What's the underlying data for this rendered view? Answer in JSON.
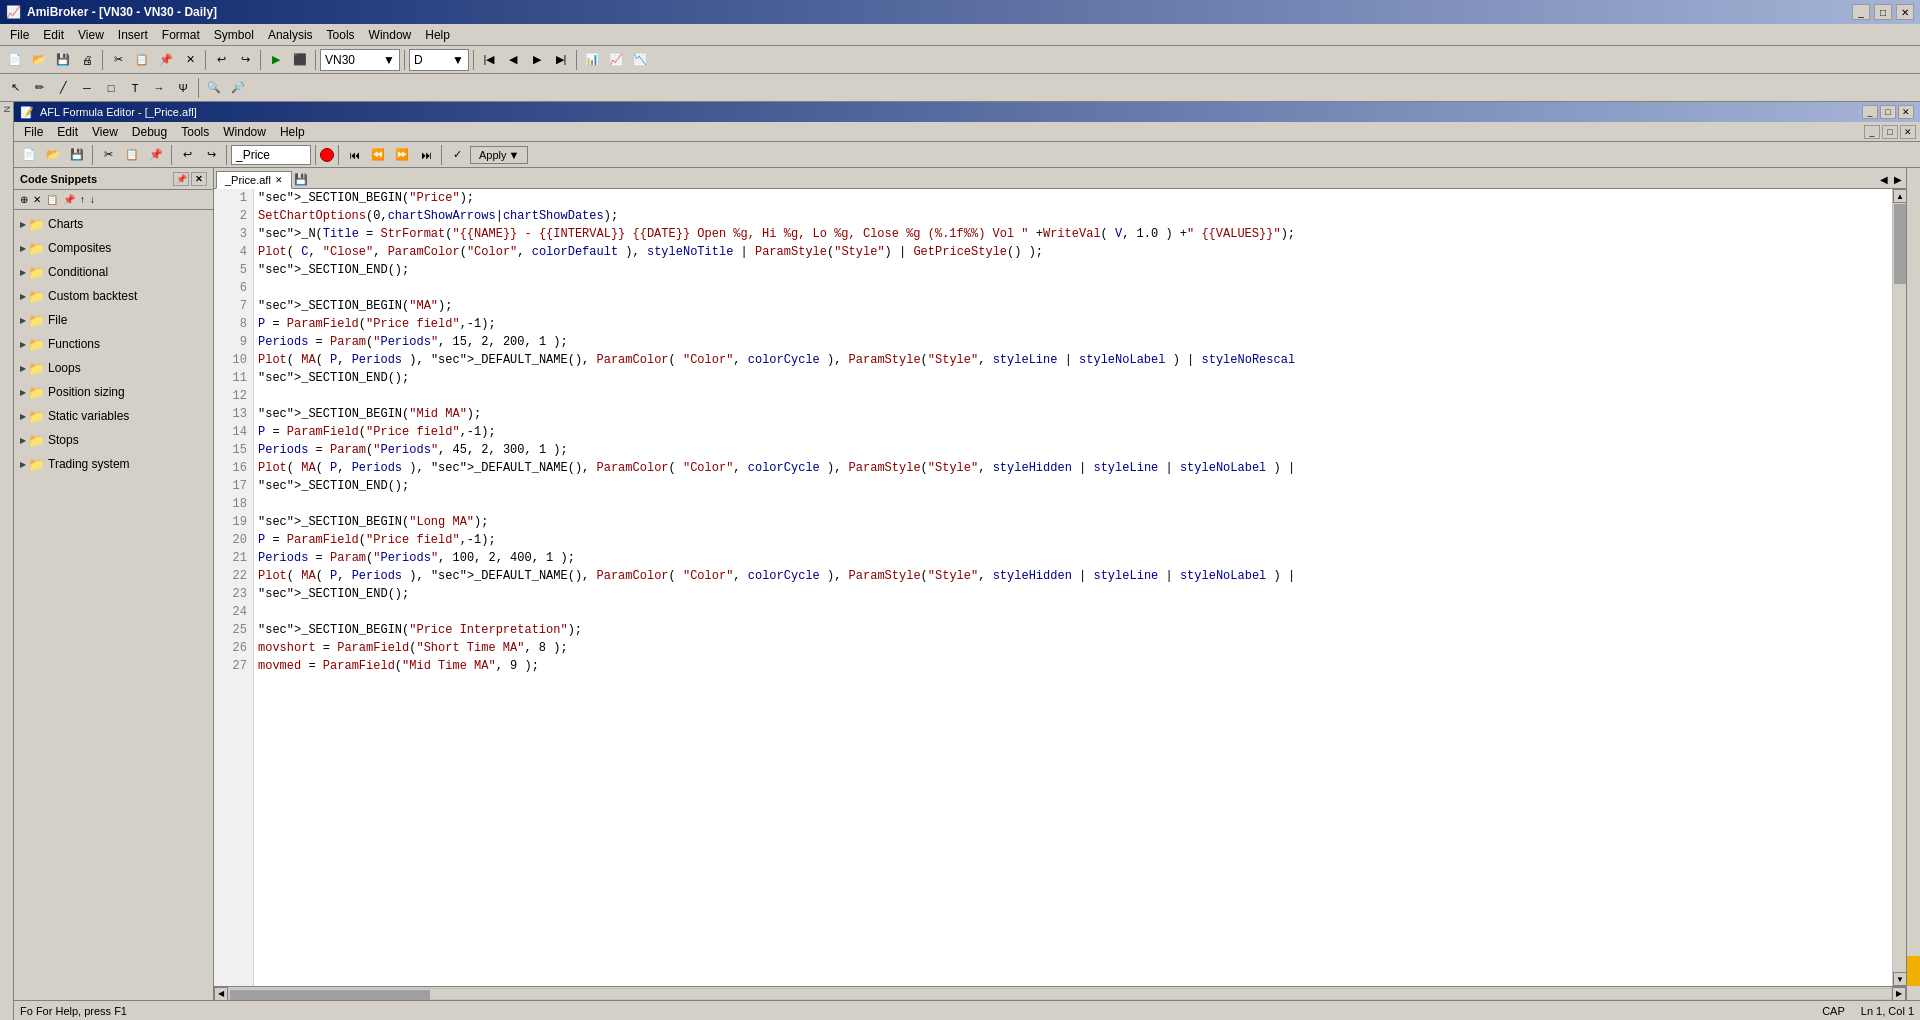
{
  "titleBar": {
    "title": "AmiBroker - [VN30 - VN30 - Daily]",
    "icon": "📈",
    "buttons": [
      "_",
      "□",
      "✕"
    ]
  },
  "mainMenu": {
    "items": [
      "File",
      "Edit",
      "View",
      "Insert",
      "Format",
      "Symbol",
      "Analysis",
      "Tools",
      "Window",
      "Help"
    ]
  },
  "toolbar": {
    "symbolDropdown": "VN30",
    "periodDropdown": "D"
  },
  "editorWindow": {
    "title": "AFL Formula Editor - [_Price.afl]",
    "filename": "_Price.afl",
    "menus": [
      "File",
      "Edit",
      "View",
      "Debug",
      "Tools",
      "Window",
      "Help"
    ],
    "filenameInput": "_Price"
  },
  "snippetsPanel": {
    "title": "Code Snippets",
    "items": [
      {
        "label": "Charts",
        "type": "folder",
        "expanded": false
      },
      {
        "label": "Composites",
        "type": "folder",
        "expanded": false
      },
      {
        "label": "Conditional",
        "type": "folder",
        "expanded": false
      },
      {
        "label": "Custom backtest",
        "type": "folder",
        "expanded": false
      },
      {
        "label": "File",
        "type": "folder",
        "expanded": false
      },
      {
        "label": "Functions",
        "type": "folder",
        "expanded": false
      },
      {
        "label": "Loops",
        "type": "folder",
        "expanded": false
      },
      {
        "label": "Position sizing",
        "type": "folder",
        "expanded": false
      },
      {
        "label": "Static variables",
        "type": "folder",
        "expanded": false
      },
      {
        "label": "Stops",
        "type": "folder",
        "expanded": false
      },
      {
        "label": "Trading system",
        "type": "folder",
        "expanded": false
      }
    ]
  },
  "tabs": [
    {
      "label": "_Price.afl",
      "active": true,
      "closable": true
    }
  ],
  "codeLines": [
    {
      "num": 1,
      "code": "_SECTION_BEGIN(\"Price\");"
    },
    {
      "num": 2,
      "code": "SetChartOptions(0,chartShowArrows|chartShowDates);"
    },
    {
      "num": 3,
      "code": "_N(Title = StrFormat(\"{{NAME}} - {{INTERVAL}} {{DATE}} Open %g, Hi %g, Lo %g, Close %g (%.1f%%) Vol \" +WriteVal( V, 1.0 ) +\" {{VALUES}}\");"
    },
    {
      "num": 4,
      "code": "Plot( C, \"Close\", ParamColor(\"Color\", colorDefault ), styleNoTitle | ParamStyle(\"Style\") | GetPriceStyle() );"
    },
    {
      "num": 5,
      "code": "_SECTION_END();"
    },
    {
      "num": 6,
      "code": ""
    },
    {
      "num": 7,
      "code": "_SECTION_BEGIN(\"MA\");"
    },
    {
      "num": 8,
      "code": "P = ParamField(\"Price field\",-1);"
    },
    {
      "num": 9,
      "code": "Periods = Param(\"Periods\", 15, 2, 200, 1 );"
    },
    {
      "num": 10,
      "code": "Plot( MA( P, Periods ), _DEFAULT_NAME(), ParamColor( \"Color\", colorCycle ), ParamStyle(\"Style\", styleLine | styleNoLabel ) | styleNoRescal"
    },
    {
      "num": 11,
      "code": "_SECTION_END();"
    },
    {
      "num": 12,
      "code": ""
    },
    {
      "num": 13,
      "code": "_SECTION_BEGIN(\"Mid MA\");"
    },
    {
      "num": 14,
      "code": "P = ParamField(\"Price field\",-1);"
    },
    {
      "num": 15,
      "code": "Periods = Param(\"Periods\", 45, 2, 300, 1 );"
    },
    {
      "num": 16,
      "code": "Plot( MA( P, Periods ), _DEFAULT_NAME(), ParamColor( \"Color\", colorCycle ), ParamStyle(\"Style\", styleHidden | styleLine | styleNoLabel ) |"
    },
    {
      "num": 17,
      "code": "_SECTION_END();"
    },
    {
      "num": 18,
      "code": ""
    },
    {
      "num": 19,
      "code": "_SECTION_BEGIN(\"Long MA\");"
    },
    {
      "num": 20,
      "code": "P = ParamField(\"Price field\",-1);"
    },
    {
      "num": 21,
      "code": "Periods = Param(\"Periods\", 100, 2, 400, 1 );"
    },
    {
      "num": 22,
      "code": "Plot( MA( P, Periods ), _DEFAULT_NAME(), ParamColor( \"Color\", colorCycle ), ParamStyle(\"Style\", styleHidden | styleLine | styleNoLabel ) |"
    },
    {
      "num": 23,
      "code": "_SECTION_END();"
    },
    {
      "num": 24,
      "code": ""
    },
    {
      "num": 25,
      "code": "_SECTION_BEGIN(\"Price Interpretation\");"
    },
    {
      "num": 26,
      "code": "movshort = ParamField(\"Short Time MA\", 8 );"
    },
    {
      "num": 27,
      "code": "movmed = ParamField(\"Mid Time MA\", 9 );"
    }
  ],
  "statusBar": {
    "left": "Fo For Help, press F1",
    "cap": "CAP",
    "position": "Ln 1, Col 1"
  }
}
